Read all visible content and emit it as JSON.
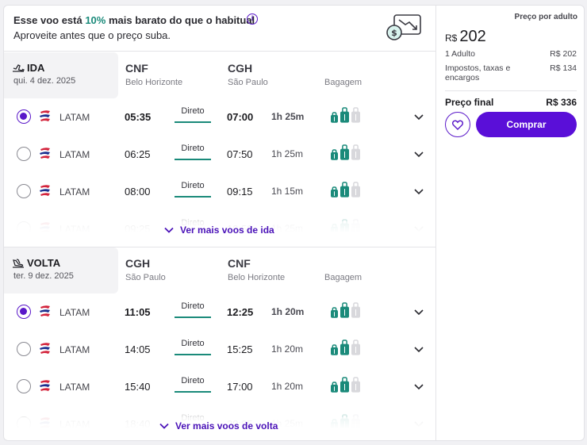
{
  "promo": {
    "prefix": "Esse voo está ",
    "percent": "10%",
    "suffix": " mais barato do que o habitual",
    "subtitle": "Aproveite antes que o preço suba."
  },
  "outbound": {
    "label": "IDA",
    "date": "qui. 4 dez. 2025",
    "origin_code": "CNF",
    "origin_city": "Belo Horizonte",
    "dest_code": "CGH",
    "dest_city": "São Paulo",
    "baggage_label": "Bagagem",
    "more_label": "Ver mais voos de ida",
    "flights": [
      {
        "airline": "LATAM",
        "dep": "05:35",
        "stops": "Direto",
        "arr": "07:00",
        "duration": "1h 25m",
        "selected": true
      },
      {
        "airline": "LATAM",
        "dep": "06:25",
        "stops": "Direto",
        "arr": "07:50",
        "duration": "1h 25m",
        "selected": false
      },
      {
        "airline": "LATAM",
        "dep": "08:00",
        "stops": "Direto",
        "arr": "09:15",
        "duration": "1h 15m",
        "selected": false
      },
      {
        "airline": "LATAM",
        "dep": "09:25",
        "stops": "Direto",
        "arr": "10:50",
        "duration": "1h 25m",
        "selected": false
      }
    ]
  },
  "return": {
    "label": "VOLTA",
    "date": "ter. 9 dez. 2025",
    "origin_code": "CGH",
    "origin_city": "São Paulo",
    "dest_code": "CNF",
    "dest_city": "Belo Horizonte",
    "baggage_label": "Bagagem",
    "more_label": "Ver mais voos de volta",
    "flights": [
      {
        "airline": "LATAM",
        "dep": "11:05",
        "stops": "Direto",
        "arr": "12:25",
        "duration": "1h 20m",
        "selected": true
      },
      {
        "airline": "LATAM",
        "dep": "14:05",
        "stops": "Direto",
        "arr": "15:25",
        "duration": "1h 20m",
        "selected": false
      },
      {
        "airline": "LATAM",
        "dep": "15:40",
        "stops": "Direto",
        "arr": "17:00",
        "duration": "1h 20m",
        "selected": false
      },
      {
        "airline": "LATAM",
        "dep": "18:40",
        "stops": "Direto",
        "arr": "20:05",
        "duration": "1h 25m",
        "selected": false
      }
    ]
  },
  "summary": {
    "per_adult_label": "Preço por adulto",
    "currency": "R$",
    "per_adult_price": "202",
    "adult_label": "1 Adulto",
    "adult_value": "R$ 202",
    "taxes_label_1": "Impostos, taxas e",
    "taxes_label_2": "encargos",
    "taxes_value": "R$ 134",
    "final_label": "Preço final",
    "final_value": "R$ 336",
    "buy_label": "Comprar"
  },
  "colors": {
    "accent": "#5a0fd8",
    "green": "#1a8a7a"
  }
}
